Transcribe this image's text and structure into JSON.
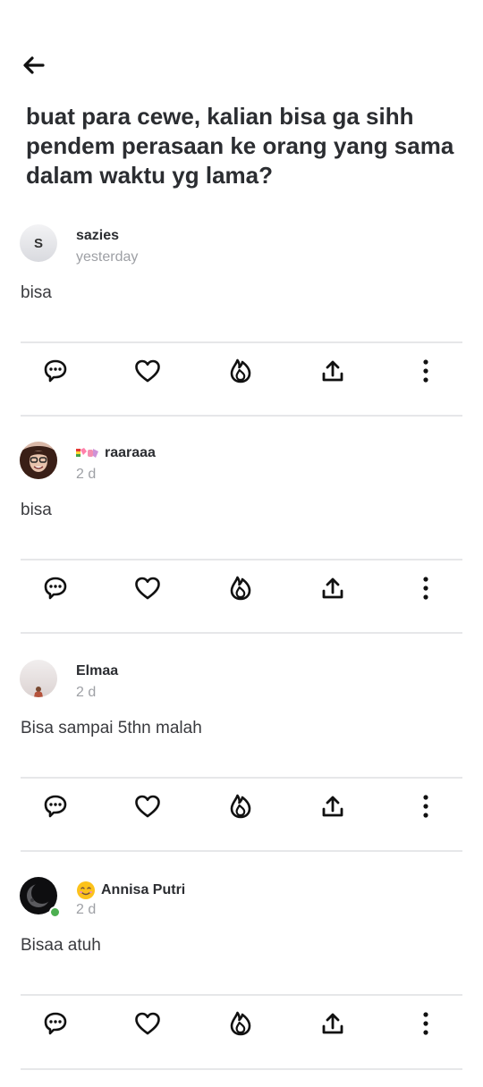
{
  "post": {
    "title": "buat para cewe, kalian bisa ga sihh pendem perasaan ke orang yang sama dalam waktu yg lama?"
  },
  "comments": [
    {
      "username": "sazies",
      "avatar_letter": "S",
      "time": "yesterday",
      "text": "bisa"
    },
    {
      "username": "raaraaa",
      "time": "2 d",
      "text": "bisa"
    },
    {
      "username": "Elmaa",
      "time": "2 d",
      "text": "Bisa sampai 5thn malah"
    },
    {
      "username": "Annisa Putri",
      "time": "2 d",
      "text": "Bisaa atuh"
    }
  ],
  "icons": {
    "back": "arrow-left-icon",
    "reply": "speech-bubble-icon",
    "like": "heart-icon",
    "fire": "flame-icon",
    "share": "share-upload-icon",
    "more": "more-vertical-icon"
  }
}
